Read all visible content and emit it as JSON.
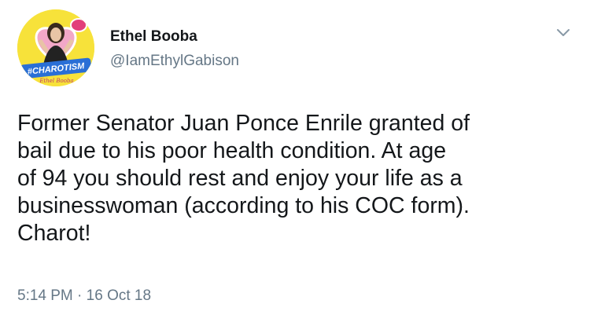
{
  "author": {
    "display_name": "Ethel Booba",
    "handle": "@IamEthylGabison",
    "avatar_text": "#CHAROTISM",
    "avatar_signature": "Ethel Booba"
  },
  "tweet": {
    "text_lines": [
      "Former Senator Juan Ponce Enrile granted of",
      "bail due to his poor health condition. At age",
      "of 94 you should rest and enjoy your life as a",
      "businesswoman (according to his COC form).",
      "Charot!"
    ],
    "time": "5:14 PM",
    "separator": "·",
    "date": "16 Oct 18"
  },
  "icons": {
    "menu": "chevron-down-icon"
  },
  "colors": {
    "name": "#14171a",
    "secondary": "#657786",
    "avatar_bg": "#f7e23a"
  }
}
